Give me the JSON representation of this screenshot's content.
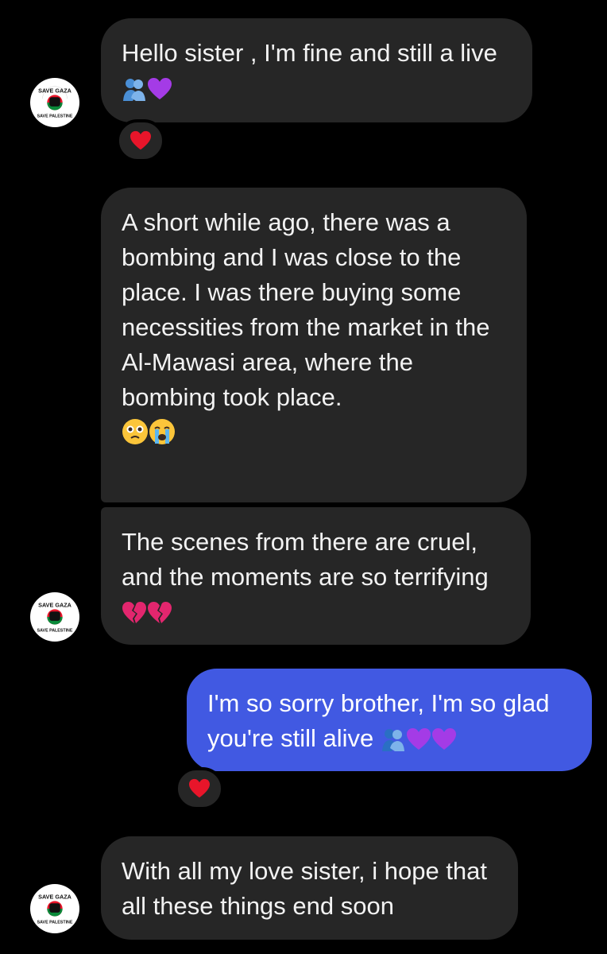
{
  "contact": {
    "avatar_icon": "save-gaza-logo-icon",
    "avatar_top_text": "SAVE GAZA",
    "avatar_bottom_text": "SAVE PALESTINE"
  },
  "messages": [
    {
      "sender": "contact",
      "text": "Hello sister , I'm fine and still a live",
      "emoji": [
        "people-hugging",
        "purple-heart"
      ],
      "reaction": "red-heart"
    },
    {
      "sender": "contact",
      "text": "A short while ago, there was a bombing and I was close to the place. I was there buying some necessities from the market in the Al-Mawasi area, where the bombing took place.",
      "emoji": [
        "face-holding-back-tears",
        "loudly-crying-face"
      ]
    },
    {
      "sender": "contact",
      "text": "The scenes from there are cruel, and the moments are so terrifying",
      "emoji": [
        "broken-heart",
        "broken-heart"
      ]
    },
    {
      "sender": "me",
      "text": "I'm so sorry brother, I'm so glad you're still alive",
      "emoji": [
        "people-hugging",
        "purple-heart",
        "purple-heart"
      ],
      "reaction": "red-heart"
    },
    {
      "sender": "contact",
      "text": "With all my love sister, i hope that all these things end soon"
    }
  ],
  "colors": {
    "background": "#000000",
    "incoming_bubble": "#262626",
    "outgoing_bubble": "#4159e2",
    "reaction_heart": "#e8152a",
    "purple_heart": "#a43be6",
    "broken_heart": "#e3266e"
  }
}
